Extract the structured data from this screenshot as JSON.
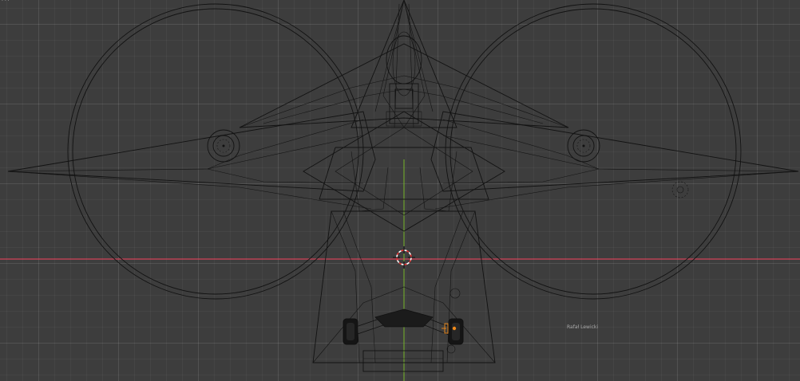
{
  "viewport": {
    "object_label": "Rafał Lewicki",
    "corner_text": "· · ·",
    "colors": {
      "background": "#3d3d3d",
      "x_axis": "#d2435a",
      "y_axis": "#78b82a",
      "wireframe": "#121212",
      "selection": "#f08a1a"
    },
    "icons": {
      "cursor": "3d-cursor-icon"
    }
  }
}
